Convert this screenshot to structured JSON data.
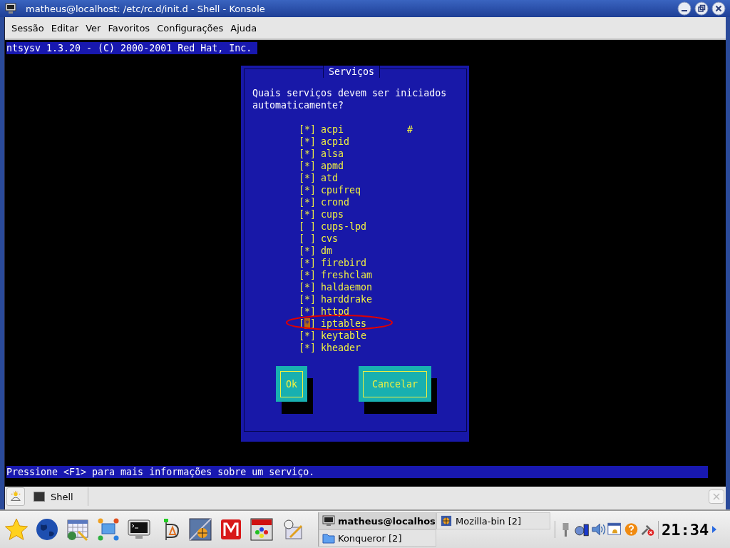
{
  "window": {
    "title": "matheus@localhost: /etc/rc.d/init.d - Shell - Konsole"
  },
  "menu": [
    "Sessão",
    "Editar",
    "Ver",
    "Favoritos",
    "Configurações",
    "Ajuda"
  ],
  "terminal": {
    "header": "ntsysv 1.3.20 - (C) 2000-2001 Red Hat, Inc.",
    "dialog": {
      "title": "Serviços",
      "question": "Quais serviços devem ser iniciados automaticamente?",
      "check_open": "[",
      "check_mark": "*",
      "check_close": "]",
      "scroll_indicator": "#",
      "services": [
        {
          "name": "acpi",
          "checked": true,
          "selected": false,
          "circled": false
        },
        {
          "name": "acpid",
          "checked": true,
          "selected": false,
          "circled": false
        },
        {
          "name": "alsa",
          "checked": true,
          "selected": false,
          "circled": false
        },
        {
          "name": "apmd",
          "checked": true,
          "selected": false,
          "circled": false
        },
        {
          "name": "atd",
          "checked": true,
          "selected": false,
          "circled": false
        },
        {
          "name": "cpufreq",
          "checked": true,
          "selected": false,
          "circled": false
        },
        {
          "name": "crond",
          "checked": true,
          "selected": false,
          "circled": false
        },
        {
          "name": "cups",
          "checked": true,
          "selected": false,
          "circled": false
        },
        {
          "name": "cups-lpd",
          "checked": false,
          "selected": false,
          "circled": false
        },
        {
          "name": "cvs",
          "checked": false,
          "selected": false,
          "circled": false
        },
        {
          "name": "dm",
          "checked": true,
          "selected": false,
          "circled": false
        },
        {
          "name": "firebird",
          "checked": true,
          "selected": false,
          "circled": false
        },
        {
          "name": "freshclam",
          "checked": true,
          "selected": false,
          "circled": false
        },
        {
          "name": "haldaemon",
          "checked": true,
          "selected": false,
          "circled": false
        },
        {
          "name": "harddrake",
          "checked": true,
          "selected": false,
          "circled": false
        },
        {
          "name": "httpd",
          "checked": true,
          "selected": false,
          "circled": false
        },
        {
          "name": "iptables",
          "checked": true,
          "selected": true,
          "circled": true
        },
        {
          "name": "keytable",
          "checked": true,
          "selected": false,
          "circled": false
        },
        {
          "name": "kheader",
          "checked": true,
          "selected": false,
          "circled": false
        }
      ],
      "buttons": [
        "Ok",
        "Cancelar"
      ]
    },
    "status_line": "Pressione <F1> para mais informações sobre um serviço."
  },
  "tabs": [
    {
      "label": "Shell",
      "selected": true
    }
  ],
  "taskbar": {
    "tasks": [
      {
        "label": "matheus@localhos",
        "active": true
      },
      {
        "label": "Mozilla-bin [2]",
        "active": false
      },
      {
        "label": "Konqueror [2]",
        "active": false
      }
    ],
    "clock": "21:34"
  }
}
